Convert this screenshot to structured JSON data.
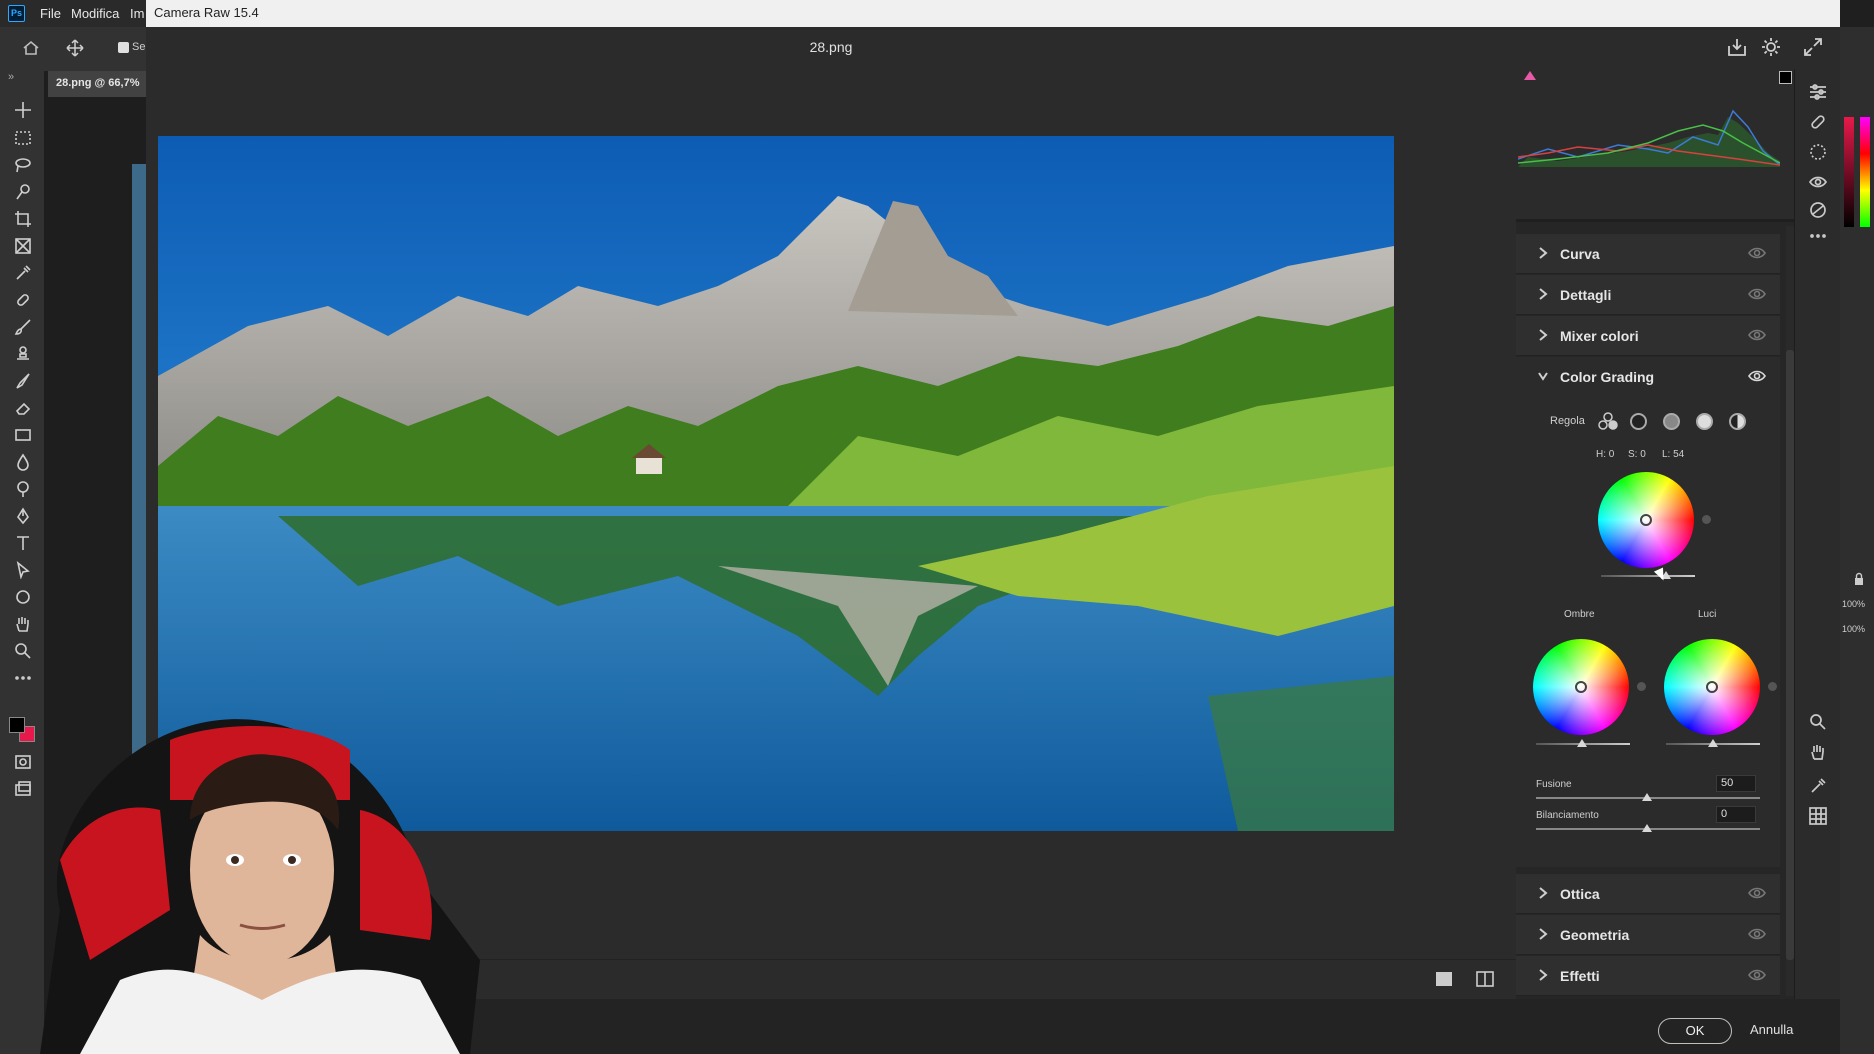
{
  "photoshop": {
    "logo": "Ps",
    "menu": [
      "File",
      "Modifica",
      "Im"
    ],
    "document_tab": "28.png @ 66,7%",
    "options_checkbox_label": "Se"
  },
  "camera_raw": {
    "window_title": "Camera Raw 15.4",
    "filename": "28.png",
    "sections_top": [
      {
        "label": "Curva"
      },
      {
        "label": "Dettagli"
      },
      {
        "label": "Mixer colori"
      }
    ],
    "color_grading": {
      "label": "Color Grading",
      "adjust_label": "Regola",
      "hsl_readout": {
        "h": "H: 0",
        "s": "S: 0",
        "l": "L: 54"
      },
      "shadows_label": "Ombre",
      "highlights_label": "Luci",
      "blend_label": "Fusione",
      "blend_value": "50",
      "balance_label": "Bilanciamento",
      "balance_value": "0"
    },
    "sections_bottom": [
      {
        "label": "Ottica"
      },
      {
        "label": "Geometria"
      },
      {
        "label": "Effetti"
      }
    ],
    "ok_label": "OK",
    "cancel_label": "Annulla"
  },
  "right_edge": {
    "zoom_1": "100%",
    "zoom_2": "100%"
  },
  "colors": {
    "accent_foreground": "#000000",
    "accent_background": "#e8194a",
    "sky": "#1f6fbf",
    "forest": "#5aa02c"
  }
}
